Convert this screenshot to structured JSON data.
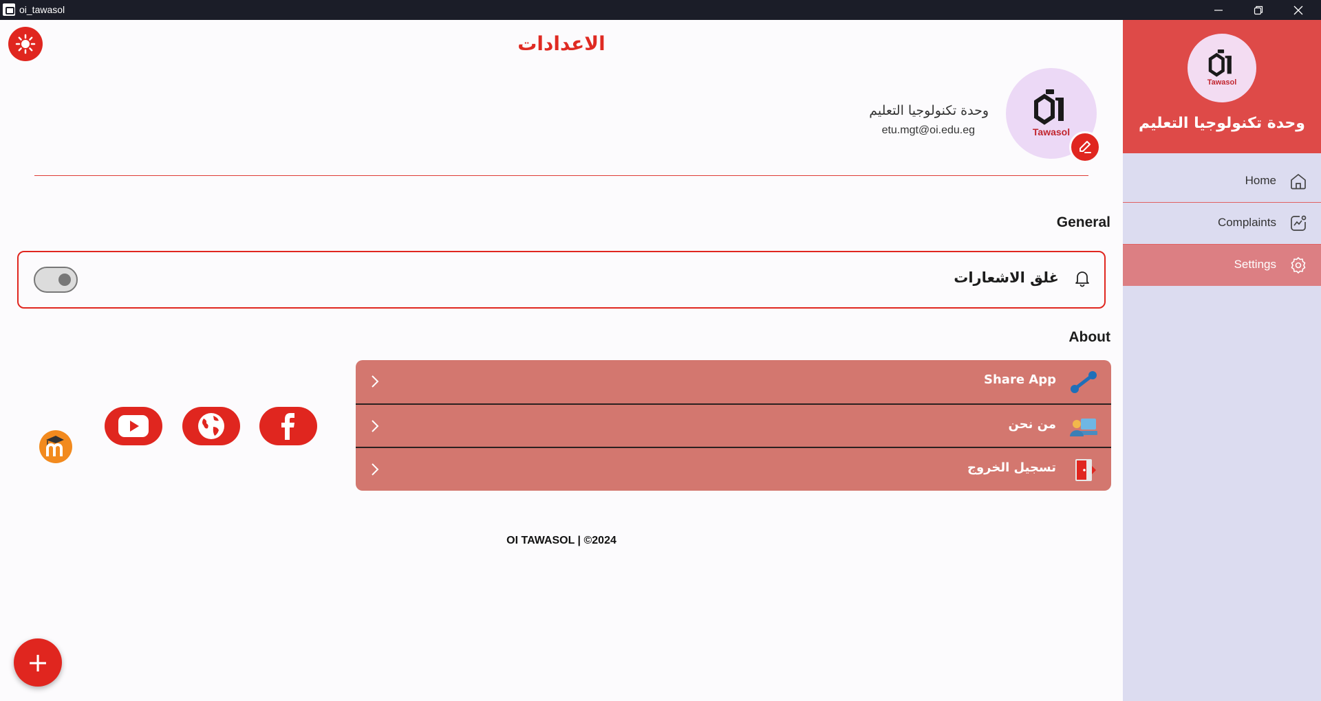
{
  "window": {
    "title": "oi_tawasol"
  },
  "page": {
    "title": "الاعدادات"
  },
  "profile": {
    "name": "وحدة تكنولوجيا التعليم",
    "email": "etu.mgt@oi.edu.eg",
    "logo_text": "Tawasol"
  },
  "general": {
    "section_label": "General",
    "notifications_label": "غلق الاشعارات",
    "notifications_enabled": false
  },
  "about": {
    "section_label": "About",
    "items": [
      {
        "label": "Share App",
        "icon": "share-icon"
      },
      {
        "label": "من نحن",
        "icon": "about-us-icon"
      },
      {
        "label": "تسجيل الخروج",
        "icon": "logout-icon"
      }
    ]
  },
  "social": [
    "facebook-icon",
    "globe-icon",
    "youtube-icon",
    "moodle-icon"
  ],
  "footer": {
    "text": "OI TAWASOL | ©2024"
  },
  "fab": {
    "label": "+"
  },
  "sidebar": {
    "logo_text": "Tawasol",
    "title": "وحدة تكنولوجيا التعليم",
    "items": [
      {
        "label": "Home",
        "icon": "home-icon",
        "active": false
      },
      {
        "label": "Complaints",
        "icon": "complaints-icon",
        "active": false
      },
      {
        "label": "Settings",
        "icon": "settings-icon",
        "active": true
      }
    ]
  },
  "colors": {
    "primary": "#e0261f",
    "sidebar_header": "#de4a48",
    "sidebar_bg": "#dcdcf0",
    "active_nav": "#dc7f83",
    "about_bg": "#d3776f"
  }
}
